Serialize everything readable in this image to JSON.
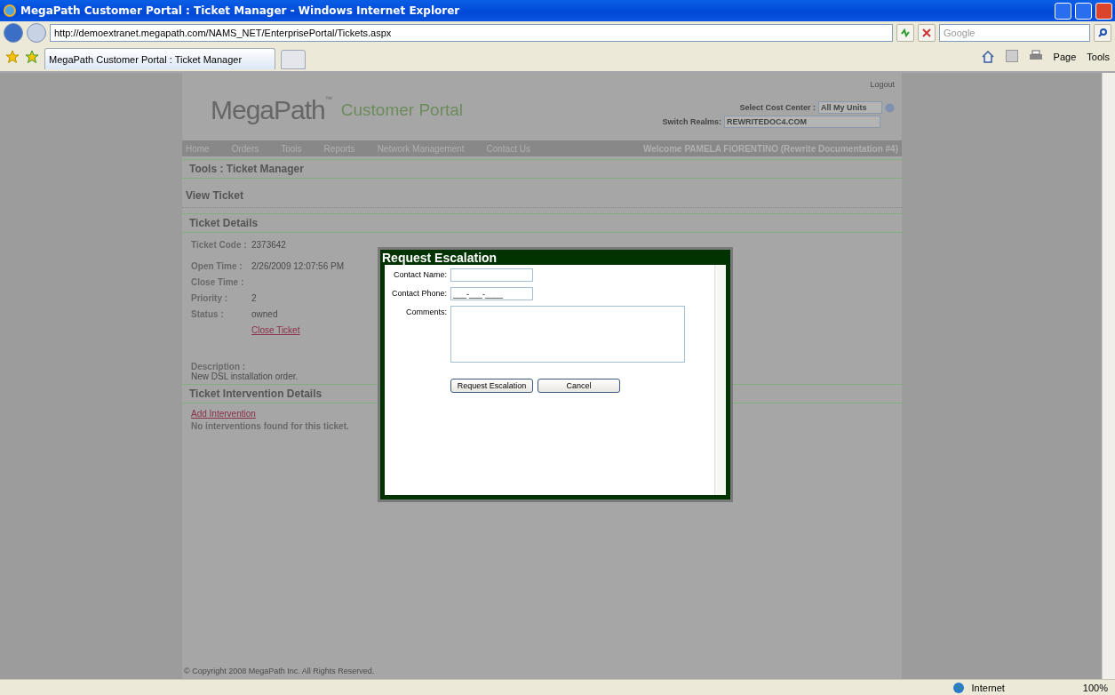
{
  "window": {
    "title": "MegaPath Customer Portal : Ticket Manager - Windows Internet Explorer"
  },
  "address_bar": {
    "url": "http://demoextranet.megapath.com/NAMS_NET/EnterprisePortal/Tickets.aspx"
  },
  "search": {
    "placeholder": "Google"
  },
  "tabs": [
    {
      "label": "MegaPath Customer Portal : Ticket Manager",
      "selected": true
    }
  ],
  "command_bar": [
    "Page",
    "Tools"
  ],
  "header": {
    "logo": "MegaPath",
    "trademark": "™",
    "tagline": "Customer Portal",
    "logout": "Logout",
    "cost_center_label": "Select Cost Center :",
    "cost_center_value": "All My Units",
    "realms_label": "Switch Realms:",
    "realms_value": "REWRITEDOC4.COM"
  },
  "nav": {
    "items": [
      "Home",
      "Orders",
      "Tools",
      "Reports",
      "Network Management",
      "Contact Us"
    ],
    "welcome": "Welcome PAMELA FIORENTINO (Rewrite Documentation #4)"
  },
  "breadcrumb": "Tools : Ticket Manager",
  "view_title": "View Ticket",
  "details": {
    "title": "Ticket Details",
    "fields": [
      {
        "label": "Ticket Code :",
        "value": "2373642"
      },
      {
        "label": "Open Time :",
        "value": "2/26/2009 12:07:56 PM"
      },
      {
        "label": "Close Time :"
      },
      {
        "label": "Priority :",
        "value": "2"
      },
      {
        "label": "Status :",
        "value": "owned"
      }
    ],
    "close_link": "Close Ticket",
    "description_label": "Description :",
    "description": "New DSL installation order."
  },
  "interventions": {
    "title": "Ticket Intervention Details",
    "add_link": "Add Intervention",
    "empty": "No interventions found for this ticket."
  },
  "footer": "© Copyright 2008 MegaPath Inc. All Rights Reserved.",
  "dialog": {
    "title": "Request Escalation",
    "fields": [
      {
        "kind": "text",
        "label": "Contact Name:"
      },
      {
        "kind": "text",
        "label": "Contact Phone:",
        "value": "___-___-____"
      },
      {
        "kind": "textarea",
        "label": "Comments:"
      }
    ],
    "buttons": [
      "Request Escalation",
      "Cancel"
    ]
  },
  "status_bar": {
    "zone": "Internet",
    "zoom": "100%"
  }
}
